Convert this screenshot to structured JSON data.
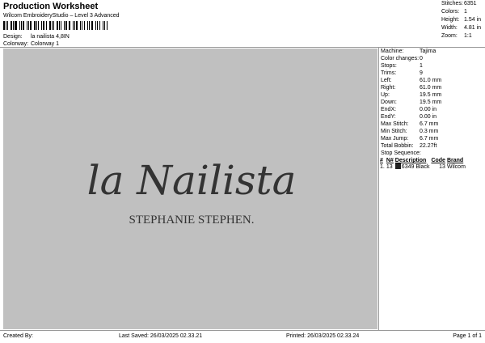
{
  "header": {
    "title": "Production Worksheet",
    "subtitle": "Wilcom EmbroideryStudio – Level 3 Advanced",
    "design_label": "Design:",
    "design_value": "la nailista 4,8IN",
    "colorway_label": "Colorway:",
    "colorway_value": "Colorway 1"
  },
  "stats": [
    {
      "label": "Stitches:",
      "value": "6351"
    },
    {
      "label": "Colors:",
      "value": "1"
    },
    {
      "label": "Height:",
      "value": "1.54 in"
    },
    {
      "label": "Width:",
      "value": "4.81 in"
    },
    {
      "label": "Zoom:",
      "value": "1:1"
    }
  ],
  "design": {
    "script_text": "la Nailista",
    "name_text": "STEPHANIE STEPHEN.",
    "thread_color": "#333333",
    "background_color": "#c0c0c0"
  },
  "properties": [
    {
      "label": "Machine:",
      "value": "Tajima"
    },
    {
      "label": "Color changes:",
      "value": "0"
    },
    {
      "label": "Stops:",
      "value": "1"
    },
    {
      "label": "Trims:",
      "value": "9"
    },
    {
      "label": "Left:",
      "value": "61.0 mm"
    },
    {
      "label": "Right:",
      "value": "61.0 mm"
    },
    {
      "label": "Up:",
      "value": "19.5 mm"
    },
    {
      "label": "Down:",
      "value": "19.5 mm"
    },
    {
      "label": "EndX:",
      "value": "0.00 in"
    },
    {
      "label": "EndY:",
      "value": "0.00 in"
    },
    {
      "label": "Max Stitch:",
      "value": "6.7 mm"
    },
    {
      "label": "Min Stitch:",
      "value": "0.3 mm"
    },
    {
      "label": "Max Jump:",
      "value": "6.7 mm"
    },
    {
      "label": "Total Bobbin:",
      "value": "22.27ft"
    }
  ],
  "stop_sequence": {
    "heading": "Stop Sequence:",
    "columns": [
      "#",
      "N#",
      "Description",
      "Code",
      "Brand"
    ],
    "rows": [
      {
        "seq": "1.",
        "n": "13",
        "color": "#222222",
        "code_num": "6349",
        "description": "Black",
        "code": "13",
        "brand": "Wilcom"
      }
    ]
  },
  "footer": {
    "created": "Created By:",
    "saved": "Last Saved: 26/03/2025 02.33.21",
    "printed": "Printed: 26/03/2025 02.33.24",
    "page": "Page 1 of 1"
  }
}
